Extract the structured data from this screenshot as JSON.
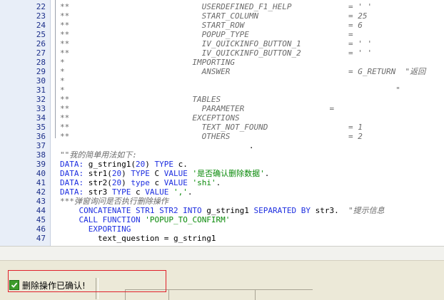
{
  "editor": {
    "lines": [
      {
        "num": "22",
        "segments": [
          {
            "t": "**                            USERDEFINED_F1_HELP            = ' '",
            "c": "comment"
          }
        ]
      },
      {
        "num": "23",
        "segments": [
          {
            "t": "**                            START_COLUMN                   = 25",
            "c": "comment"
          }
        ]
      },
      {
        "num": "24",
        "segments": [
          {
            "t": "**                            START_ROW                      = 6",
            "c": "comment"
          }
        ]
      },
      {
        "num": "25",
        "segments": [
          {
            "t": "**                            POPUP_TYPE                     =",
            "c": "comment"
          }
        ]
      },
      {
        "num": "26",
        "segments": [
          {
            "t": "**                            IV_QUICKINFO_BUTTON_1          = ' '",
            "c": "comment"
          }
        ]
      },
      {
        "num": "27",
        "segments": [
          {
            "t": "**                            IV_QUICKINFO_BUTTON_2          = ' '",
            "c": "comment"
          }
        ]
      },
      {
        "num": "28",
        "segments": [
          {
            "t": "*                           IMPORTING",
            "c": "comment"
          }
        ]
      },
      {
        "num": "29",
        "segments": [
          {
            "t": "*                             ANSWER                         = G_RETURN  \"返回",
            "c": "comment"
          }
        ]
      },
      {
        "num": "30",
        "segments": [
          {
            "t": "*",
            "c": "comment"
          }
        ]
      },
      {
        "num": "31",
        "segments": [
          {
            "t": "*                                                                      \"",
            "c": "comment"
          }
        ]
      },
      {
        "num": "32",
        "segments": [
          {
            "t": "**                          TABLES",
            "c": "comment"
          }
        ]
      },
      {
        "num": "33",
        "segments": [
          {
            "t": "**                            PARAMETER                  =",
            "c": "comment"
          }
        ]
      },
      {
        "num": "34",
        "segments": [
          {
            "t": "**                          EXCEPTIONS",
            "c": "comment"
          }
        ]
      },
      {
        "num": "35",
        "segments": [
          {
            "t": "**                            TEXT_NOT_FOUND                 = 1",
            "c": "comment"
          }
        ]
      },
      {
        "num": "36",
        "segments": [
          {
            "t": "**                            OTHERS                         = 2",
            "c": "comment"
          }
        ]
      },
      {
        "num": "37",
        "segments": [
          {
            "t": "                                        .",
            "c": "plain"
          }
        ]
      },
      {
        "num": "38",
        "segments": [
          {
            "t": "\"\"我的简单用法如下:",
            "c": "comment"
          }
        ]
      },
      {
        "num": "39",
        "segments": [
          {
            "t": "DATA:",
            "c": "kw"
          },
          {
            "t": " g_string1(",
            "c": "plain"
          },
          {
            "t": "20",
            "c": "num"
          },
          {
            "t": ") ",
            "c": "plain"
          },
          {
            "t": "TYPE",
            "c": "kw"
          },
          {
            "t": " c.",
            "c": "plain"
          }
        ]
      },
      {
        "num": "40",
        "segments": [
          {
            "t": "DATA:",
            "c": "kw"
          },
          {
            "t": " str1(",
            "c": "plain"
          },
          {
            "t": "20",
            "c": "num"
          },
          {
            "t": ") ",
            "c": "plain"
          },
          {
            "t": "TYPE",
            "c": "kw"
          },
          {
            "t": " C ",
            "c": "plain"
          },
          {
            "t": "VALUE",
            "c": "kw"
          },
          {
            "t": " ",
            "c": "plain"
          },
          {
            "t": "'是否确认删除数据'",
            "c": "str"
          },
          {
            "t": ".",
            "c": "plain"
          }
        ]
      },
      {
        "num": "41",
        "segments": [
          {
            "t": "DATA:",
            "c": "kw"
          },
          {
            "t": " str2(",
            "c": "plain"
          },
          {
            "t": "20",
            "c": "num"
          },
          {
            "t": ") ",
            "c": "plain"
          },
          {
            "t": "type",
            "c": "kw"
          },
          {
            "t": " c ",
            "c": "plain"
          },
          {
            "t": "VALUE",
            "c": "kw"
          },
          {
            "t": " ",
            "c": "plain"
          },
          {
            "t": "'shi'",
            "c": "str"
          },
          {
            "t": ".",
            "c": "plain"
          }
        ]
      },
      {
        "num": "42",
        "segments": [
          {
            "t": "DATA:",
            "c": "kw"
          },
          {
            "t": " str3 ",
            "c": "plain"
          },
          {
            "t": "TYPE",
            "c": "kw"
          },
          {
            "t": " c ",
            "c": "plain"
          },
          {
            "t": "VALUE",
            "c": "kw"
          },
          {
            "t": " ",
            "c": "plain"
          },
          {
            "t": "','",
            "c": "str"
          },
          {
            "t": ".",
            "c": "plain"
          }
        ]
      },
      {
        "num": "43",
        "segments": [
          {
            "t": "***弹窗询问是否执行删除操作",
            "c": "comment"
          }
        ]
      },
      {
        "num": "44",
        "segments": [
          {
            "t": "    CONCATENATE STR1 STR2 INTO",
            "c": "kw"
          },
          {
            "t": " g_string1 ",
            "c": "plain"
          },
          {
            "t": "SEPARATED BY",
            "c": "kw"
          },
          {
            "t": " str3.  ",
            "c": "plain"
          },
          {
            "t": "\"提示信息",
            "c": "comment"
          }
        ]
      },
      {
        "num": "45",
        "segments": [
          {
            "t": "    CALL FUNCTION",
            "c": "kw"
          },
          {
            "t": " ",
            "c": "plain"
          },
          {
            "t": "'POPUP_TO_CONFIRM'",
            "c": "str"
          }
        ]
      },
      {
        "num": "46",
        "segments": [
          {
            "t": "      EXPORTING",
            "c": "kw"
          }
        ]
      },
      {
        "num": "47",
        "segments": [
          {
            "t": "        text_question = g_string1",
            "c": "plain"
          }
        ]
      }
    ]
  },
  "status": {
    "message": "删除操作已确认!",
    "icon": "success-check-icon"
  },
  "colors": {
    "keyword": "#1d2ee0",
    "string": "#0a8a0a",
    "comment": "#6b6b6b",
    "highlight": "#e0202a"
  }
}
